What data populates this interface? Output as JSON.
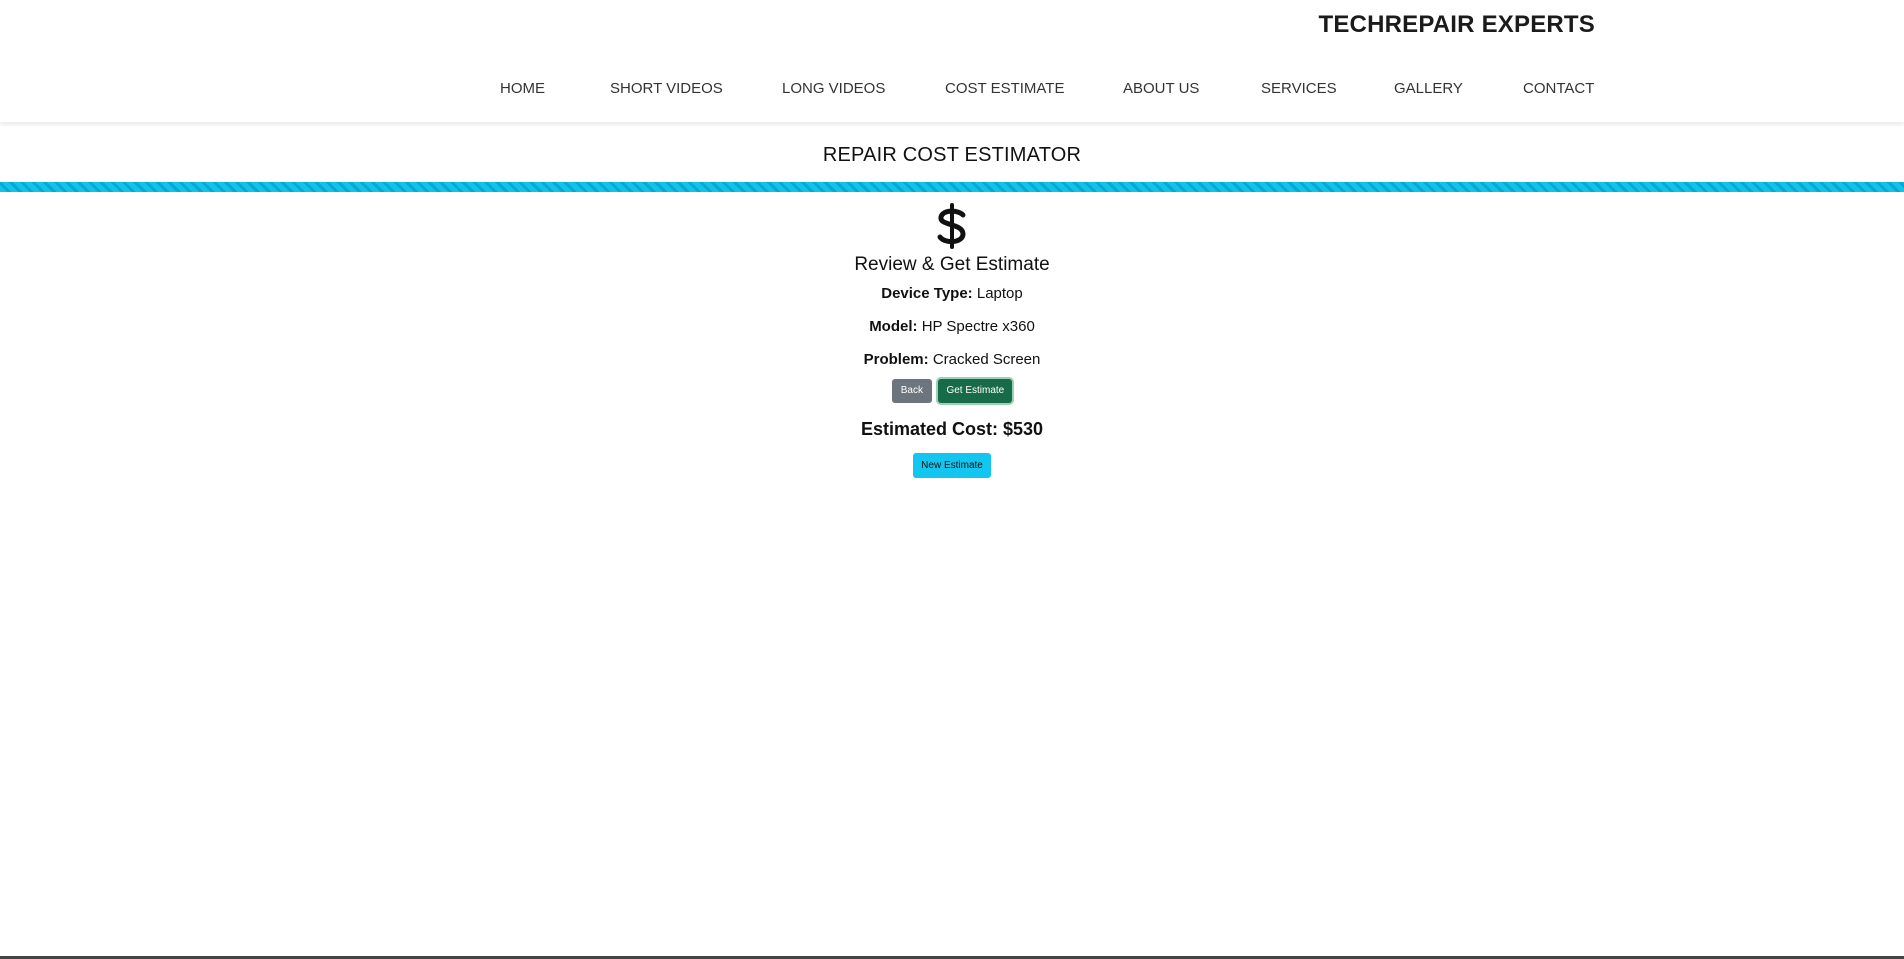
{
  "header": {
    "brand": "TECHREPAIR EXPERTS",
    "nav": [
      {
        "label": "HOME"
      },
      {
        "label": "SHORT VIDEOS"
      },
      {
        "label": "LONG VIDEOS"
      },
      {
        "label": "COST ESTIMATE"
      },
      {
        "label": "ABOUT US"
      },
      {
        "label": "SERVICES"
      },
      {
        "label": "GALLERY"
      },
      {
        "label": "CONTACT"
      }
    ]
  },
  "banner": {
    "title": "REPAIR COST ESTIMATOR"
  },
  "estimate": {
    "icon": "dollar-sign",
    "heading": "Review & Get Estimate",
    "details": {
      "device_type_label": "Device Type:",
      "device_type_value": "Laptop",
      "model_label": "Model:",
      "model_value": "HP Spectre x360",
      "problem_label": "Problem:",
      "problem_value": "Cracked Screen"
    },
    "buttons": {
      "back": "Back",
      "get_estimate": "Get Estimate",
      "new_estimate": "New Estimate"
    },
    "result": "Estimated Cost: $530"
  },
  "colors": {
    "accent_stripe": "#11c3ea",
    "back_button": "#6c757d",
    "get_estimate_button": "#176b48",
    "new_estimate_button": "#12c6ef"
  }
}
